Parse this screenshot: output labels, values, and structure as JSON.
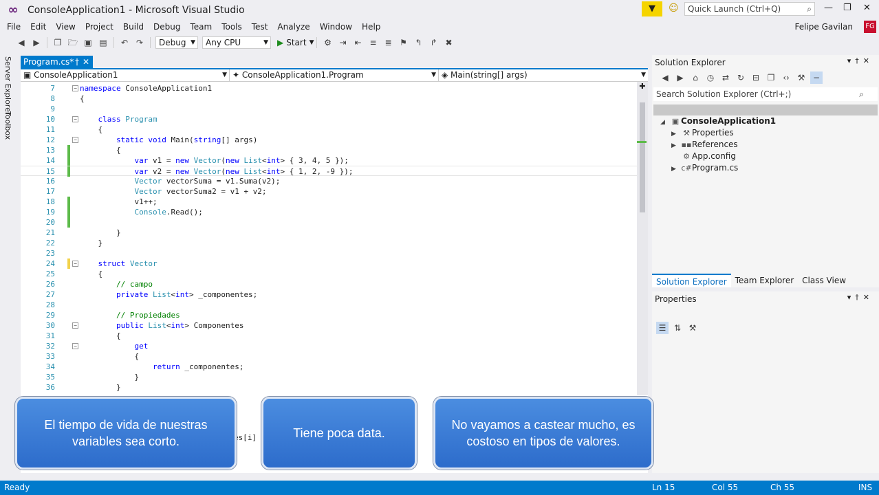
{
  "window": {
    "title": "ConsoleApplication1 - Microsoft Visual Studio",
    "quick_launch_placeholder": "Quick Launch (Ctrl+Q)",
    "user": "Felipe Gavilan",
    "user_initials": "FG"
  },
  "menu": [
    "File",
    "Edit",
    "View",
    "Project",
    "Build",
    "Debug",
    "Team",
    "Tools",
    "Test",
    "Analyze",
    "Window",
    "Help"
  ],
  "toolbar": {
    "config": "Debug",
    "platform": "Any CPU",
    "start_label": "Start"
  },
  "side_tabs": [
    "Server Explorer",
    "Toolbox"
  ],
  "document_tab": "Program.cs*",
  "navbar": {
    "project": "ConsoleApplication1",
    "class": "ConsoleApplication1.Program",
    "member": "Main(string[] args)"
  },
  "code_lines": [
    {
      "n": "7",
      "t": "namespace ConsoleApplication1"
    },
    {
      "n": "8",
      "t": "{"
    },
    {
      "n": "9",
      "t": ""
    },
    {
      "n": "10",
      "t": "    class Program"
    },
    {
      "n": "11",
      "t": "    {"
    },
    {
      "n": "12",
      "t": "        static void Main(string[] args)"
    },
    {
      "n": "13",
      "t": "        {"
    },
    {
      "n": "14",
      "t": "            var v1 = new Vector(new List<int> { 3, 4, 5 });"
    },
    {
      "n": "15",
      "t": "            var v2 = new Vector(new List<int> { 1, 2, -9 });"
    },
    {
      "n": "16",
      "t": "            Vector vectorSuma = v1.Suma(v2);"
    },
    {
      "n": "17",
      "t": "            Vector vectorSuma2 = v1 + v2;"
    },
    {
      "n": "18",
      "t": "            v1++;"
    },
    {
      "n": "19",
      "t": "            Console.Read();"
    },
    {
      "n": "20",
      "t": ""
    },
    {
      "n": "21",
      "t": "        }"
    },
    {
      "n": "22",
      "t": "    }"
    },
    {
      "n": "23",
      "t": ""
    },
    {
      "n": "24",
      "t": "    struct Vector"
    },
    {
      "n": "25",
      "t": "    {"
    },
    {
      "n": "26",
      "t": "        // campo"
    },
    {
      "n": "27",
      "t": "        private List<int> _componentes;"
    },
    {
      "n": "28",
      "t": ""
    },
    {
      "n": "29",
      "t": "        // Propiedades"
    },
    {
      "n": "30",
      "t": "        public List<int> Componentes"
    },
    {
      "n": "31",
      "t": "        {"
    },
    {
      "n": "32",
      "t": "            get"
    },
    {
      "n": "33",
      "t": "            {"
    },
    {
      "n": "34",
      "t": "                return _componentes;"
    },
    {
      "n": "35",
      "t": "            }"
    },
    {
      "n": "36",
      "t": "        }"
    }
  ],
  "partial_code": "es[i]",
  "solution_explorer": {
    "title": "Solution Explorer",
    "search_placeholder": "Search Solution Explorer (Ctrl+;)",
    "items": [
      {
        "label": "ConsoleApplication1",
        "bold": true
      },
      {
        "label": "Properties"
      },
      {
        "label": "References"
      },
      {
        "label": "App.config"
      },
      {
        "label": "Program.cs"
      }
    ],
    "tabs": [
      "Solution Explorer",
      "Team Explorer",
      "Class View"
    ]
  },
  "properties": {
    "title": "Properties"
  },
  "captions": [
    "El tiempo de vida de nuestras variables sea corto.",
    "Tiene poca data.",
    "No vayamos a castear mucho, es costoso en tipos de valores."
  ],
  "status": {
    "state": "Ready",
    "ln": "Ln 15",
    "col": "Col 55",
    "ch": "Ch 55",
    "mode": "INS"
  },
  "colors": {
    "accent": "#007acc",
    "caption_bg": "#3b7bd6"
  }
}
